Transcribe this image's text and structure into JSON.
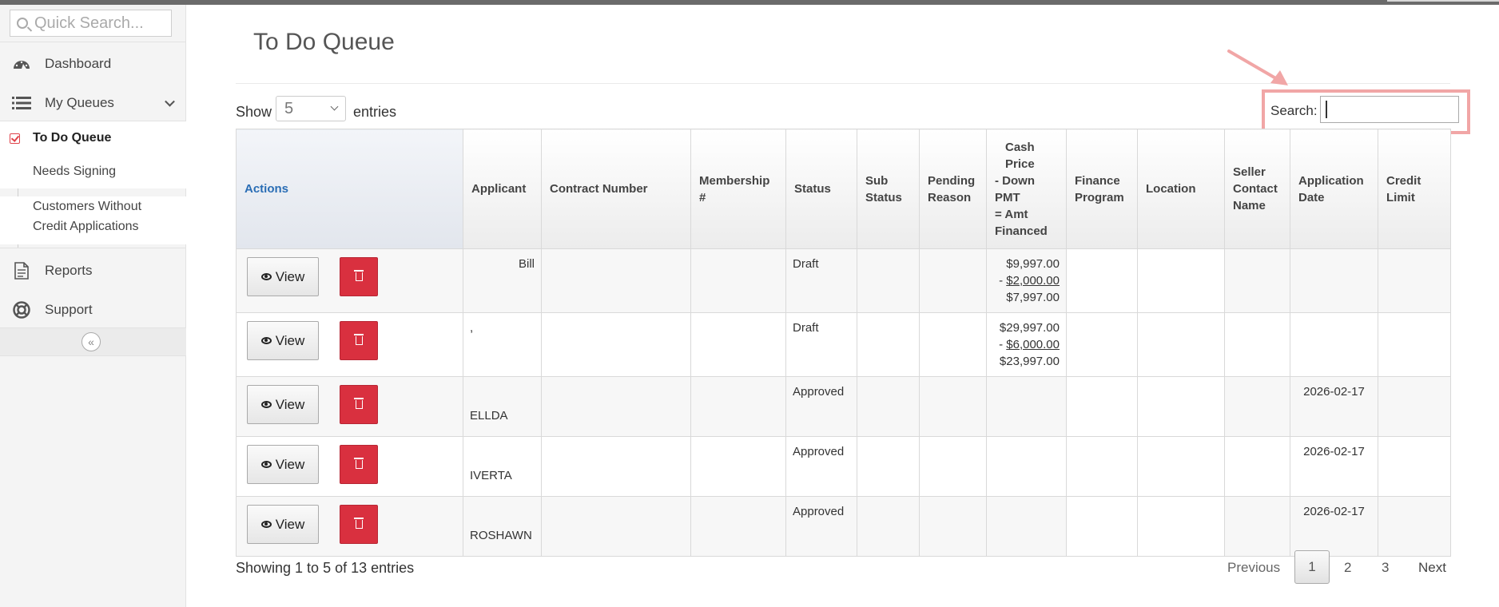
{
  "sidebar": {
    "quick_search_placeholder": "Quick Search...",
    "dashboard": "Dashboard",
    "my_queues": "My Queues",
    "sub_items": [
      "To Do Queue",
      "Needs Signing",
      "Customers Without",
      "Credit Applications"
    ],
    "reports": "Reports",
    "support": "Support"
  },
  "page": {
    "title": "To Do Queue",
    "show_label": "Show",
    "entries_value": "5",
    "entries_label": "entries",
    "search_label": "Search:",
    "search_value": ""
  },
  "table": {
    "headers": {
      "actions": "Actions",
      "applicant": "Applicant",
      "contract_number": "Contract Number",
      "membership": "Membership #",
      "status": "Status",
      "sub_status": "Sub Status",
      "pending_reason": "Pending Reason",
      "cash_price": "Cash Price",
      "down_pmt": "- Down PMT",
      "amt_financed": "= Amt Financed",
      "finance_program": "Finance Program",
      "location": "Location",
      "seller_contact": "Seller Contact Name",
      "application_date": "Application Date",
      "credit_limit": "Credit Limit"
    },
    "view_label": "View",
    "rows": [
      {
        "applicant": "Bill",
        "status": "Draft",
        "cash": "$9,997.00",
        "down": "$2,000.00",
        "financed": "$7,997.00",
        "date": ""
      },
      {
        "applicant": ",",
        "status": "Draft",
        "cash": "$29,997.00",
        "down": "$6,000.00",
        "financed": "$23,997.00",
        "date": ""
      },
      {
        "applicant": "ELLDA",
        "status": "Approved",
        "cash": "",
        "down": "",
        "financed": "",
        "date": "2026-02-17"
      },
      {
        "applicant": "IVERTA",
        "status": "Approved",
        "cash": "",
        "down": "",
        "financed": "",
        "date": "2026-02-17"
      },
      {
        "applicant": "ROSHAWN",
        "status": "Approved",
        "cash": "",
        "down": "",
        "financed": "",
        "date": "2026-02-17"
      }
    ]
  },
  "footer": {
    "info": "Showing 1 to 5 of 13 entries",
    "previous": "Previous",
    "pages": [
      "1",
      "2",
      "3"
    ],
    "next": "Next"
  }
}
